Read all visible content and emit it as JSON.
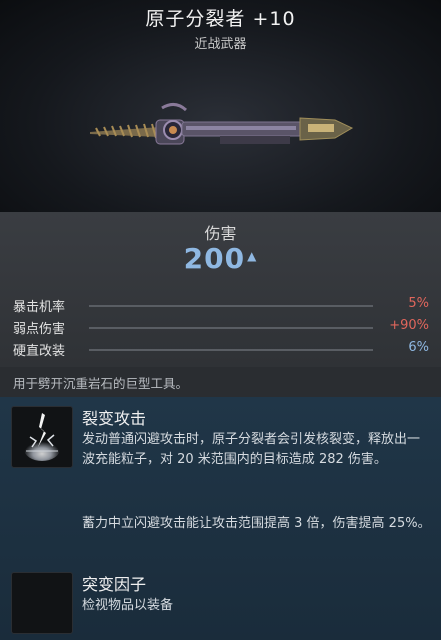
{
  "weapon": {
    "name": "原子分裂者 +10",
    "type": "近战武器"
  },
  "damage": {
    "label": "伤害",
    "value": "200"
  },
  "stats": [
    {
      "label": "暴击机率",
      "value": "5%",
      "color": "#e0665c"
    },
    {
      "label": "弱点伤害",
      "value": "+90%",
      "color": "#e0665c"
    },
    {
      "label": "硬直改装",
      "value": "6%",
      "color": "#8fb8e2"
    }
  ],
  "description": "用于劈开沉重岩石的巨型工具。",
  "mod": {
    "title": "裂变攻击",
    "text": "发动普通闪避攻击时，原子分裂者会引发核裂变，释放出一波充能粒子，对 20 米范围内的目标造成 282 伤害。",
    "text2": "蓄力中立闪避攻击能让攻击范围提高 3 倍，伤害提高 25%。"
  },
  "mutator": {
    "title": "突变因子",
    "text": "检视物品以装备"
  },
  "icons": {
    "up": "caret-up-icon",
    "weapon": "atom-splitter-weapon-image",
    "mod": "fission-lightning-icon",
    "mutator": "empty-mutator-slot"
  }
}
